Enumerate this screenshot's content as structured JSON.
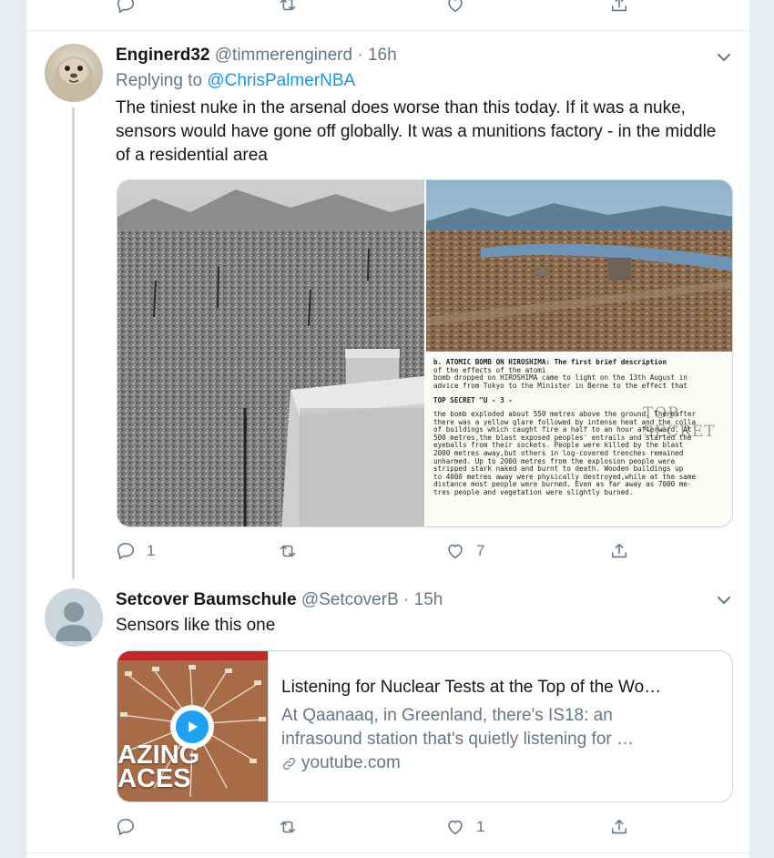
{
  "top_actions": {
    "reply": "",
    "retweet": "",
    "like": "",
    "share": ""
  },
  "tweet1": {
    "name": "Enginerd32",
    "handle": "@timmerenginerd",
    "separator": "·",
    "time": "16h",
    "replying_prefix": "Replying to",
    "replying_mention": "@ChrisPalmerNBA",
    "text": "The tiniest nuke in the arsenal does worse than this today. If it was a nuke, sensors would have gone off globally. It was a munitions factory - in the middle of a residential area",
    "media": {
      "document_lines": [
        "b. ATOMIC BOMB ON HIROSHIMA:  The first brief description",
        "                        of the effects of the atomi",
        "bomb dropped on HIROSHIMA came to light on the 13th August in",
        "advice from Tokyo to the Minister in Berne to the effect that",
        "TOP SECRET \"U                - 3 -",
        "the bomb exploded about 550 metres above the ground. Thereafter",
        "there was a yellow glare followed by intense heat and the colla",
        "of buildings which caught fire a half to an hour afterward. At",
        "500 metres,the blast exposed peoples' entrails and started the",
        "eyeballs from their sockets. People were killed by the blast",
        "2000 metres away,but others in log-covered trenches remained",
        "unharmed. Up to 2000 metres from the explosion people were",
        "stripped stark naked and burnt to death. Wooden buildings up",
        "to 4000 metres away were physically destroyed,while at the same",
        "distance most people were burned. Even as far away as 7000 me-",
        "tres people and vegetation were slightly burned."
      ],
      "stamp": "TOP SECRET"
    },
    "actions": {
      "replies": "1",
      "retweets": "",
      "likes": "7",
      "share": ""
    }
  },
  "tweet2": {
    "name": "Setcover Baumschule",
    "handle": "@SetcoverB",
    "separator": "·",
    "time": "15h",
    "text": "Sensors like this one",
    "card": {
      "title": "Listening for Nuclear Tests at the Top of the Wo…",
      "description_line1": "At Qaanaaq, in Greenland, there's IS18: an",
      "description_line2": "infrasound station that's quietly listening for …",
      "domain": "youtube.com",
      "thumb_text_line1": "AZING",
      "thumb_text_line2": "ACES"
    },
    "actions": {
      "replies": "",
      "retweets": "",
      "likes": "1",
      "share": ""
    }
  },
  "colors": {
    "link": "#1b95e0",
    "secondary": "#657786",
    "border": "#e6ecf0",
    "thread_line": "#ccd6dd",
    "play": "#1da1f2"
  }
}
